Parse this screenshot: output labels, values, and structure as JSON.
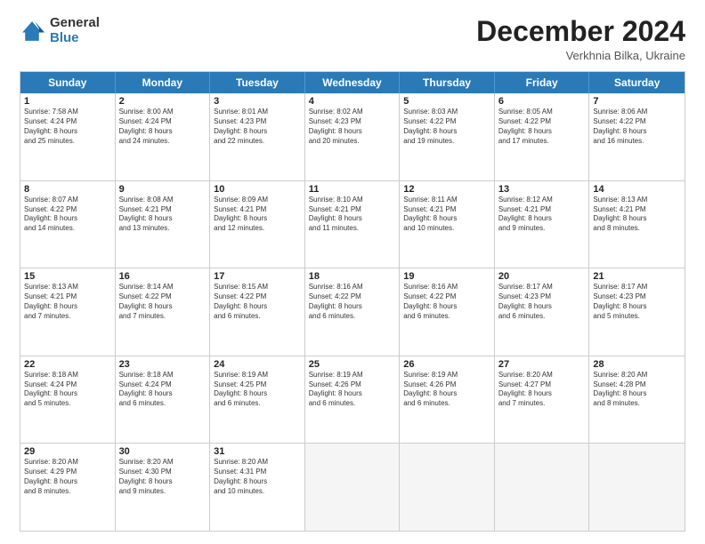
{
  "logo": {
    "general": "General",
    "blue": "Blue"
  },
  "title": "December 2024",
  "subtitle": "Verkhnia Bilka, Ukraine",
  "days": [
    "Sunday",
    "Monday",
    "Tuesday",
    "Wednesday",
    "Thursday",
    "Friday",
    "Saturday"
  ],
  "weeks": [
    [
      {
        "num": "1",
        "info": "Sunrise: 7:58 AM\nSunset: 4:24 PM\nDaylight: 8 hours\nand 25 minutes."
      },
      {
        "num": "2",
        "info": "Sunrise: 8:00 AM\nSunset: 4:24 PM\nDaylight: 8 hours\nand 24 minutes."
      },
      {
        "num": "3",
        "info": "Sunrise: 8:01 AM\nSunset: 4:23 PM\nDaylight: 8 hours\nand 22 minutes."
      },
      {
        "num": "4",
        "info": "Sunrise: 8:02 AM\nSunset: 4:23 PM\nDaylight: 8 hours\nand 20 minutes."
      },
      {
        "num": "5",
        "info": "Sunrise: 8:03 AM\nSunset: 4:22 PM\nDaylight: 8 hours\nand 19 minutes."
      },
      {
        "num": "6",
        "info": "Sunrise: 8:05 AM\nSunset: 4:22 PM\nDaylight: 8 hours\nand 17 minutes."
      },
      {
        "num": "7",
        "info": "Sunrise: 8:06 AM\nSunset: 4:22 PM\nDaylight: 8 hours\nand 16 minutes."
      }
    ],
    [
      {
        "num": "8",
        "info": "Sunrise: 8:07 AM\nSunset: 4:22 PM\nDaylight: 8 hours\nand 14 minutes."
      },
      {
        "num": "9",
        "info": "Sunrise: 8:08 AM\nSunset: 4:21 PM\nDaylight: 8 hours\nand 13 minutes."
      },
      {
        "num": "10",
        "info": "Sunrise: 8:09 AM\nSunset: 4:21 PM\nDaylight: 8 hours\nand 12 minutes."
      },
      {
        "num": "11",
        "info": "Sunrise: 8:10 AM\nSunset: 4:21 PM\nDaylight: 8 hours\nand 11 minutes."
      },
      {
        "num": "12",
        "info": "Sunrise: 8:11 AM\nSunset: 4:21 PM\nDaylight: 8 hours\nand 10 minutes."
      },
      {
        "num": "13",
        "info": "Sunrise: 8:12 AM\nSunset: 4:21 PM\nDaylight: 8 hours\nand 9 minutes."
      },
      {
        "num": "14",
        "info": "Sunrise: 8:13 AM\nSunset: 4:21 PM\nDaylight: 8 hours\nand 8 minutes."
      }
    ],
    [
      {
        "num": "15",
        "info": "Sunrise: 8:13 AM\nSunset: 4:21 PM\nDaylight: 8 hours\nand 7 minutes."
      },
      {
        "num": "16",
        "info": "Sunrise: 8:14 AM\nSunset: 4:22 PM\nDaylight: 8 hours\nand 7 minutes."
      },
      {
        "num": "17",
        "info": "Sunrise: 8:15 AM\nSunset: 4:22 PM\nDaylight: 8 hours\nand 6 minutes."
      },
      {
        "num": "18",
        "info": "Sunrise: 8:16 AM\nSunset: 4:22 PM\nDaylight: 8 hours\nand 6 minutes."
      },
      {
        "num": "19",
        "info": "Sunrise: 8:16 AM\nSunset: 4:22 PM\nDaylight: 8 hours\nand 6 minutes."
      },
      {
        "num": "20",
        "info": "Sunrise: 8:17 AM\nSunset: 4:23 PM\nDaylight: 8 hours\nand 6 minutes."
      },
      {
        "num": "21",
        "info": "Sunrise: 8:17 AM\nSunset: 4:23 PM\nDaylight: 8 hours\nand 5 minutes."
      }
    ],
    [
      {
        "num": "22",
        "info": "Sunrise: 8:18 AM\nSunset: 4:24 PM\nDaylight: 8 hours\nand 5 minutes."
      },
      {
        "num": "23",
        "info": "Sunrise: 8:18 AM\nSunset: 4:24 PM\nDaylight: 8 hours\nand 6 minutes."
      },
      {
        "num": "24",
        "info": "Sunrise: 8:19 AM\nSunset: 4:25 PM\nDaylight: 8 hours\nand 6 minutes."
      },
      {
        "num": "25",
        "info": "Sunrise: 8:19 AM\nSunset: 4:26 PM\nDaylight: 8 hours\nand 6 minutes."
      },
      {
        "num": "26",
        "info": "Sunrise: 8:19 AM\nSunset: 4:26 PM\nDaylight: 8 hours\nand 6 minutes."
      },
      {
        "num": "27",
        "info": "Sunrise: 8:20 AM\nSunset: 4:27 PM\nDaylight: 8 hours\nand 7 minutes."
      },
      {
        "num": "28",
        "info": "Sunrise: 8:20 AM\nSunset: 4:28 PM\nDaylight: 8 hours\nand 8 minutes."
      }
    ],
    [
      {
        "num": "29",
        "info": "Sunrise: 8:20 AM\nSunset: 4:29 PM\nDaylight: 8 hours\nand 8 minutes."
      },
      {
        "num": "30",
        "info": "Sunrise: 8:20 AM\nSunset: 4:30 PM\nDaylight: 8 hours\nand 9 minutes."
      },
      {
        "num": "31",
        "info": "Sunrise: 8:20 AM\nSunset: 4:31 PM\nDaylight: 8 hours\nand 10 minutes."
      },
      {
        "num": "",
        "info": ""
      },
      {
        "num": "",
        "info": ""
      },
      {
        "num": "",
        "info": ""
      },
      {
        "num": "",
        "info": ""
      }
    ]
  ]
}
